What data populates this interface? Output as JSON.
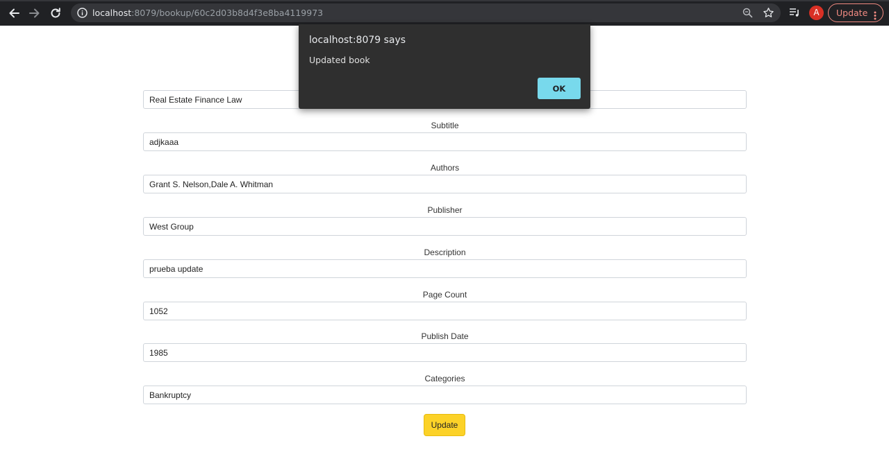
{
  "browser": {
    "url_host": "localhost",
    "url_rest": ":8079/bookup/60c2d03b8d4f3e8ba4119973",
    "avatar_letter": "A",
    "update_label": "Update",
    "icons": [
      "back-icon",
      "forward-icon",
      "reload-icon",
      "info-icon",
      "zoom-icon",
      "star-icon",
      "media-queue-icon",
      "kebab-menu-icon"
    ]
  },
  "form": {
    "title_value": "Real Estate Finance Law",
    "fields": [
      {
        "label": "Subtitle",
        "value": "adjkaaa"
      },
      {
        "label": "Authors",
        "value": "Grant S. Nelson,Dale A. Whitman"
      },
      {
        "label": "Publisher",
        "value": "West Group"
      },
      {
        "label": "Description",
        "value": "prueba update"
      },
      {
        "label": "Page Count",
        "value": "1052"
      },
      {
        "label": "Publish Date",
        "value": "1985"
      },
      {
        "label": "Categories",
        "value": "Bankruptcy"
      }
    ],
    "submit_label": "Update"
  },
  "dialog": {
    "title": "localhost:8079 says",
    "message": "Updated book",
    "ok_label": "OK"
  },
  "colors": {
    "chrome_bg": "#202124",
    "omnibox_bg": "#35363a",
    "dialog_bg": "#2f2f2f",
    "ok_button": "#78d9ec",
    "submit_button": "#fcd228",
    "chrome_update": "#f28b82"
  }
}
